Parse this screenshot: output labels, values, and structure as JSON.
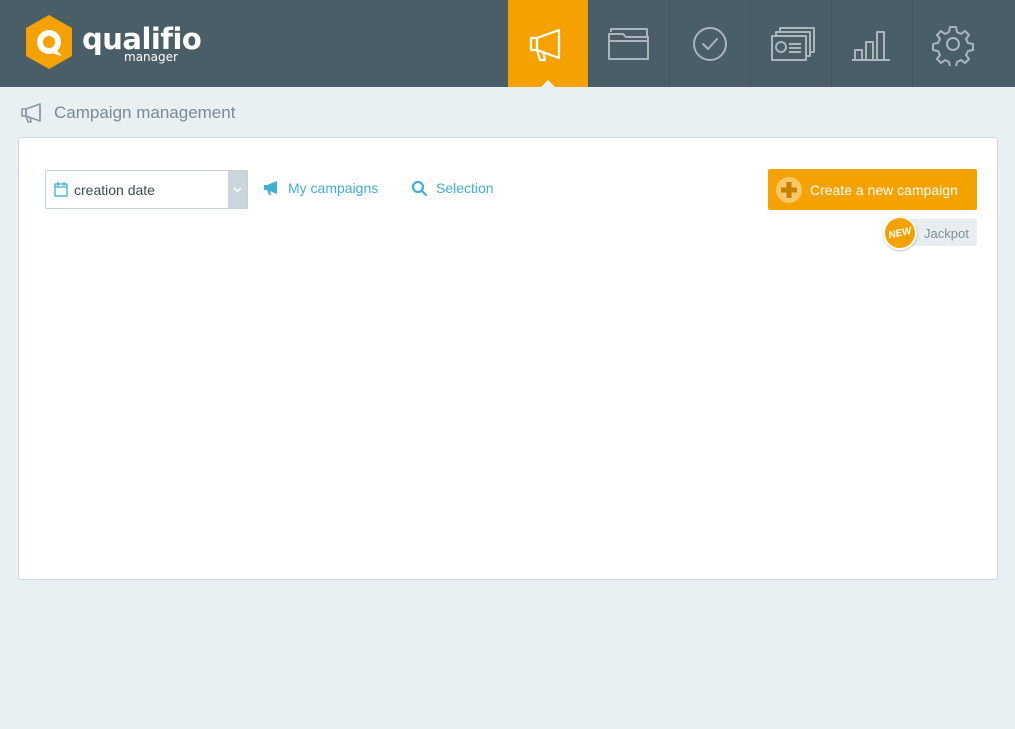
{
  "logo": {
    "name": "qualifio",
    "sub": "manager",
    "icon": "qualifio-logo-icon"
  },
  "nav": {
    "items": [
      {
        "name": "campaigns",
        "icon": "megaphone-icon",
        "active": true
      },
      {
        "name": "folders",
        "icon": "folder-icon",
        "active": false
      },
      {
        "name": "validation",
        "icon": "check-circle-icon",
        "active": false
      },
      {
        "name": "contacts",
        "icon": "id-cards-icon",
        "active": false
      },
      {
        "name": "statistics",
        "icon": "bar-chart-icon",
        "active": false
      },
      {
        "name": "settings",
        "icon": "gear-icon",
        "active": false
      }
    ]
  },
  "page": {
    "title": "Campaign management",
    "icon": "megaphone-icon"
  },
  "toolbar": {
    "sort_value": "creation date",
    "my_campaigns": "My campaigns",
    "selection": "Selection",
    "create_label": "Create a new campaign",
    "new_badge": "NEW",
    "jackpot_label": "Jackpot"
  },
  "colors": {
    "header": "#4a5e68",
    "accent": "#f5a200",
    "link": "#3fb0d4",
    "background": "#e9f0f3"
  }
}
